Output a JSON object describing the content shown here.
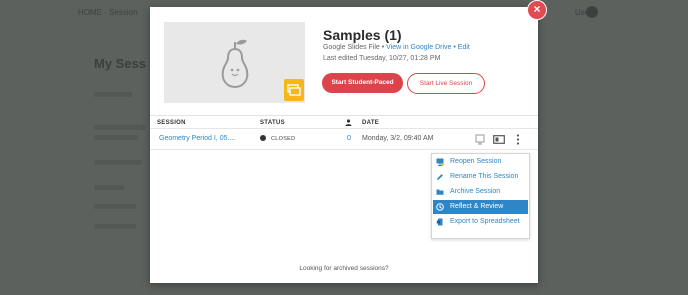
{
  "modal": {
    "title": "Samples (1)",
    "file_type": "Google Slides File",
    "view_link": "View in Google Drive",
    "edit_link": "Edit",
    "separator": "•",
    "last_edited": "Last edited Tuesday, 10/27, 01:28 PM",
    "start_student_paced": "Start Student-Paced",
    "start_live_session": "Start Live Session",
    "archived_link": "Looking for archived sessions?",
    "close_glyph": "×"
  },
  "table": {
    "headers": {
      "session": "SESSION",
      "status": "STATUS",
      "date": "DATE"
    },
    "row": {
      "name": "Geometry Period I, 05....",
      "status": "CLOSED",
      "count": "0",
      "date": "Monday, 3/2, 09:40 AM"
    }
  },
  "menu": {
    "items": [
      {
        "label": "Reopen Session",
        "icon": "monitor-icon"
      },
      {
        "label": "Rename This Session",
        "icon": "pencil-icon"
      },
      {
        "label": "Archive Session",
        "icon": "folder-icon"
      },
      {
        "label": "Reflect & Review",
        "icon": "reflect-icon",
        "active": true
      },
      {
        "label": "Export to Spreadsheet",
        "icon": "spreadsheet-icon"
      }
    ]
  },
  "background": {
    "nav_text": "HOME  ·  Session",
    "page_title": "My Sess",
    "user_text": "User"
  },
  "colors": {
    "accent_red": "#d9454b",
    "link_blue": "#2f86c6",
    "slides_yellow": "#f2b91b",
    "overlay": "#5c615e"
  }
}
